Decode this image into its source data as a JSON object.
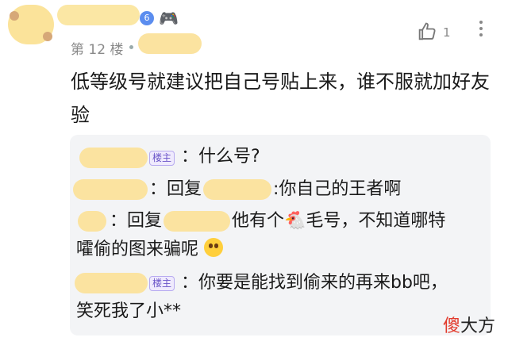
{
  "post": {
    "level_badge": "6",
    "game_icon": "gamepad-icon",
    "floor": "第 12 楼",
    "like_count": "1",
    "content": "低等级号就建议把自己号贴上来，谁不服就加好友验"
  },
  "replies": [
    {
      "owner_badge": "楼主",
      "text": "：什么号?"
    },
    {
      "reply_prefix": "：回复",
      "text": ":你自己的王者啊"
    },
    {
      "reply_prefix": "：回复",
      "text_a": "他有个",
      "text_b": "毛号，不知道哪特",
      "text_c": "嚯偷的图来骗呢"
    },
    {
      "owner_badge": "楼主",
      "text_a": "：你要是能找到偷来的再来bb吧，",
      "text_b": "笑死我了小**"
    }
  ],
  "watermark": {
    "first": "傻",
    "rest": "大方"
  },
  "colors": {
    "accent": "#5b8def",
    "owner_badge": "#6a55c8",
    "reply_bg": "#f3f4f6",
    "watermark_red": "#e23a2c"
  }
}
